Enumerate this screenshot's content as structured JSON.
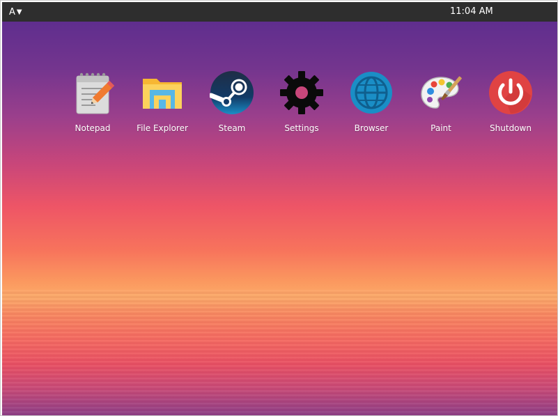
{
  "topbar": {
    "menu_label": "A",
    "menu_arrow": "▼",
    "clock": "11:04 AM"
  },
  "desktop": {
    "apps": [
      {
        "label": "Notepad",
        "icon": "notepad-icon"
      },
      {
        "label": "File Explorer",
        "icon": "folder-icon"
      },
      {
        "label": "Steam",
        "icon": "steam-icon"
      },
      {
        "label": "Settings",
        "icon": "gear-icon"
      },
      {
        "label": "Browser",
        "icon": "globe-icon"
      },
      {
        "label": "Paint",
        "icon": "palette-icon"
      },
      {
        "label": "Shutdown",
        "icon": "power-icon"
      }
    ]
  },
  "colors": {
    "topbar_bg": "#2e2e2e",
    "shutdown_red": "#e04343",
    "browser_blue": "#1a8ec6",
    "steam_navy": "#1b2838",
    "folder_yellow": "#fcd25c"
  }
}
